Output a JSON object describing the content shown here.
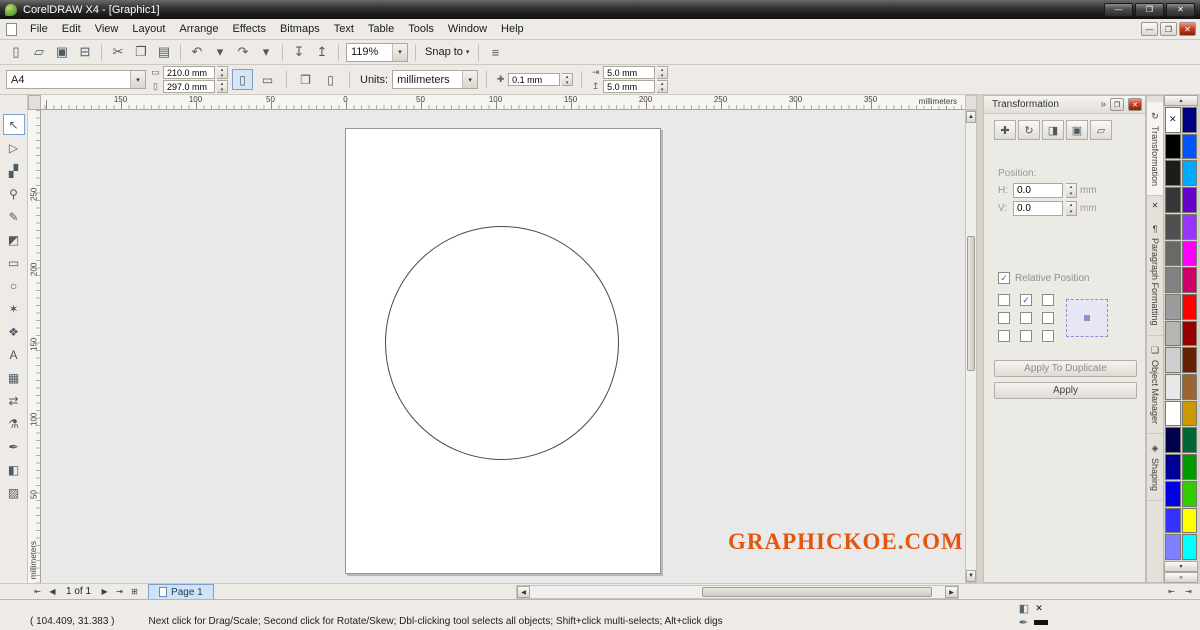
{
  "titlebar": {
    "title": "CorelDRAW X4 - [Graphic1]",
    "buttons": [
      {
        "id": "minimize-button",
        "glyph": "—"
      },
      {
        "id": "maximize-button",
        "glyph": "❐"
      },
      {
        "id": "close-button",
        "glyph": "✕"
      }
    ]
  },
  "menubar": {
    "items": [
      {
        "id": "menu-file",
        "label": "File"
      },
      {
        "id": "menu-edit",
        "label": "Edit"
      },
      {
        "id": "menu-view",
        "label": "View"
      },
      {
        "id": "menu-layout",
        "label": "Layout"
      },
      {
        "id": "menu-arrange",
        "label": "Arrange"
      },
      {
        "id": "menu-effects",
        "label": "Effects"
      },
      {
        "id": "menu-bitmaps",
        "label": "Bitmaps"
      },
      {
        "id": "menu-text",
        "label": "Text"
      },
      {
        "id": "menu-table",
        "label": "Table"
      },
      {
        "id": "menu-tools",
        "label": "Tools"
      },
      {
        "id": "menu-window",
        "label": "Window"
      },
      {
        "id": "menu-help",
        "label": "Help"
      }
    ],
    "doc_buttons": [
      {
        "id": "doc-minimize-button",
        "glyph": "—"
      },
      {
        "id": "doc-restore-button",
        "glyph": "❐"
      },
      {
        "id": "doc-close-button",
        "glyph": "✕"
      }
    ]
  },
  "toolbar": {
    "buttons": [
      {
        "id": "new-button",
        "glyph": "▯"
      },
      {
        "id": "open-button",
        "glyph": "▱"
      },
      {
        "id": "save-button",
        "glyph": "▣"
      },
      {
        "id": "print-button",
        "glyph": "⊟"
      },
      {
        "id": "separator"
      },
      {
        "id": "cut-button",
        "glyph": "✂"
      },
      {
        "id": "copy-button",
        "glyph": "❐"
      },
      {
        "id": "paste-button",
        "glyph": "▤"
      },
      {
        "id": "separator"
      },
      {
        "id": "undo-button",
        "glyph": "↶"
      },
      {
        "id": "undo-dropdown",
        "glyph": "▾"
      },
      {
        "id": "redo-button",
        "glyph": "↷"
      },
      {
        "id": "redo-dropdown",
        "glyph": "▾"
      },
      {
        "id": "separator"
      },
      {
        "id": "import-button",
        "glyph": "↧"
      },
      {
        "id": "export-button",
        "glyph": "↥"
      },
      {
        "id": "separator"
      }
    ],
    "zoom_value": "119%",
    "snap_label": "Snap to",
    "options_glyph": "≡"
  },
  "property_bar": {
    "paper_type": "A4",
    "paper_width": "210.0 mm",
    "paper_height": "297.0 mm",
    "portrait_glyph": "▯",
    "landscape_glyph": "▭",
    "all_pages_glyph": "❐",
    "current_page_glyph": "▯",
    "units_label": "Units:",
    "units_value": "millimeters",
    "nudge_glyph": "✚",
    "nudge_value": "0.1 mm",
    "dup_x_glyph": "⇥",
    "duplicate_x": "5.0 mm",
    "dup_y_glyph": "↥",
    "duplicate_y": "5.0 mm"
  },
  "rulers": {
    "h_labels": [
      "150",
      "100",
      "50",
      "0",
      "50",
      "100",
      "150",
      "200",
      "250",
      "300",
      "350"
    ],
    "v_labels": [
      "250",
      "200",
      "150",
      "100",
      "50"
    ],
    "unit": "millimeters"
  },
  "toolbox": {
    "tools": [
      {
        "id": "pick-tool",
        "glyph": "↖"
      },
      {
        "id": "shape-tool",
        "glyph": "▷"
      },
      {
        "id": "crop-tool",
        "glyph": "▞"
      },
      {
        "id": "zoom-tool",
        "glyph": "⚲"
      },
      {
        "id": "freehand-tool",
        "glyph": "✎"
      },
      {
        "id": "smart-fill-tool",
        "glyph": "◩"
      },
      {
        "id": "rectangle-tool",
        "glyph": "▭"
      },
      {
        "id": "ellipse-tool",
        "glyph": "○"
      },
      {
        "id": "polygon-tool",
        "glyph": "✶"
      },
      {
        "id": "basic-shapes-tool",
        "glyph": "❖"
      },
      {
        "id": "text-tool",
        "glyph": "A"
      },
      {
        "id": "table-tool",
        "glyph": "▦"
      },
      {
        "id": "interactive-blend-tool",
        "glyph": "⇄"
      },
      {
        "id": "eyedropper-tool",
        "glyph": "⚗"
      },
      {
        "id": "outline-tool",
        "glyph": "✒"
      },
      {
        "id": "fill-tool",
        "glyph": "◧"
      },
      {
        "id": "interactive-fill-tool",
        "glyph": "▨"
      }
    ]
  },
  "canvas": {
    "watermark": "GRAPHICKOE.COM"
  },
  "docker": {
    "title": "Transformation",
    "chevron": "»",
    "restore_glyph": "❐",
    "close_glyph": "✕",
    "tools": [
      {
        "id": "position-mode-button",
        "glyph": "✚"
      },
      {
        "id": "rotate-mode-button",
        "glyph": "↻"
      },
      {
        "id": "scale-mirror-mode-button",
        "glyph": "◨"
      },
      {
        "id": "size-mode-button",
        "glyph": "▣"
      },
      {
        "id": "skew-mode-button",
        "glyph": "▱"
      }
    ],
    "position_label": "Position:",
    "h_label": "H:",
    "h_value": "0.0",
    "h_unit": "mm",
    "v_label": "V:",
    "v_value": "0.0",
    "v_unit": "mm",
    "relative_label": "Relative Position",
    "check_glyph": "✓",
    "apply_duplicate_label": "Apply To Duplicate",
    "apply_label": "Apply"
  },
  "docker_tabs": {
    "active": {
      "id": "tab-transformation",
      "glyph": "↻",
      "label": "Transformation"
    },
    "close_glyph": "✕",
    "others": [
      {
        "id": "tab-paragraph-formatting",
        "glyph": "¶",
        "label": "Paragraph Formatting"
      },
      {
        "id": "tab-object-manager",
        "glyph": "❏",
        "label": "Object Manager"
      },
      {
        "id": "tab-shaping",
        "glyph": "◈",
        "label": "Shaping"
      }
    ]
  },
  "palette": {
    "none_glyph": "✕",
    "up_glyph": "▴",
    "down_glyph": "▾",
    "expand_glyph": "»",
    "colors": [
      "#000000",
      "#1c1c1c",
      "#363636",
      "#4f4f4f",
      "#696969",
      "#828282",
      "#9c9c9c",
      "#b5b5b5",
      "#cfcfcf",
      "#e8e8e8",
      "#ffffff",
      "#00004d",
      "#000099",
      "#0000e6",
      "#3333ff",
      "#8080ff",
      "#000080",
      "#0055ff",
      "#00aaff",
      "#6600cc",
      "#9933ff",
      "#ff00ff",
      "#cc0066",
      "#ff0000",
      "#990000",
      "#662200",
      "#996633",
      "#cc9900",
      "#006633",
      "#009900",
      "#33cc00",
      "#ffff00",
      "#00ffff"
    ]
  },
  "pagebar": {
    "nav_left": [
      {
        "id": "first-page-button",
        "glyph": "⇤"
      },
      {
        "id": "prev-page-button",
        "glyph": "◀"
      }
    ],
    "page_info": "1 of 1",
    "nav_right": [
      {
        "id": "next-page-button",
        "glyph": "▶"
      },
      {
        "id": "last-page-button",
        "glyph": "⇥"
      },
      {
        "id": "add-page-button",
        "glyph": "⊞"
      }
    ],
    "page_tab": "Page 1",
    "dock_nav": [
      {
        "id": "scroll-left-button",
        "glyph": "⇤"
      },
      {
        "id": "scroll-right-button",
        "glyph": "⇥"
      }
    ]
  },
  "statusbar": {
    "coords": "( 104.409, 31.383 )",
    "hint": "Next click for Drag/Scale; Second click for Rotate/Skew; Dbl-clicking tool selects all objects; Shift+click multi-selects; Alt+click digs",
    "fill_glyph": "◧",
    "fill_none_glyph": "✕",
    "outline_glyph": "✒"
  }
}
